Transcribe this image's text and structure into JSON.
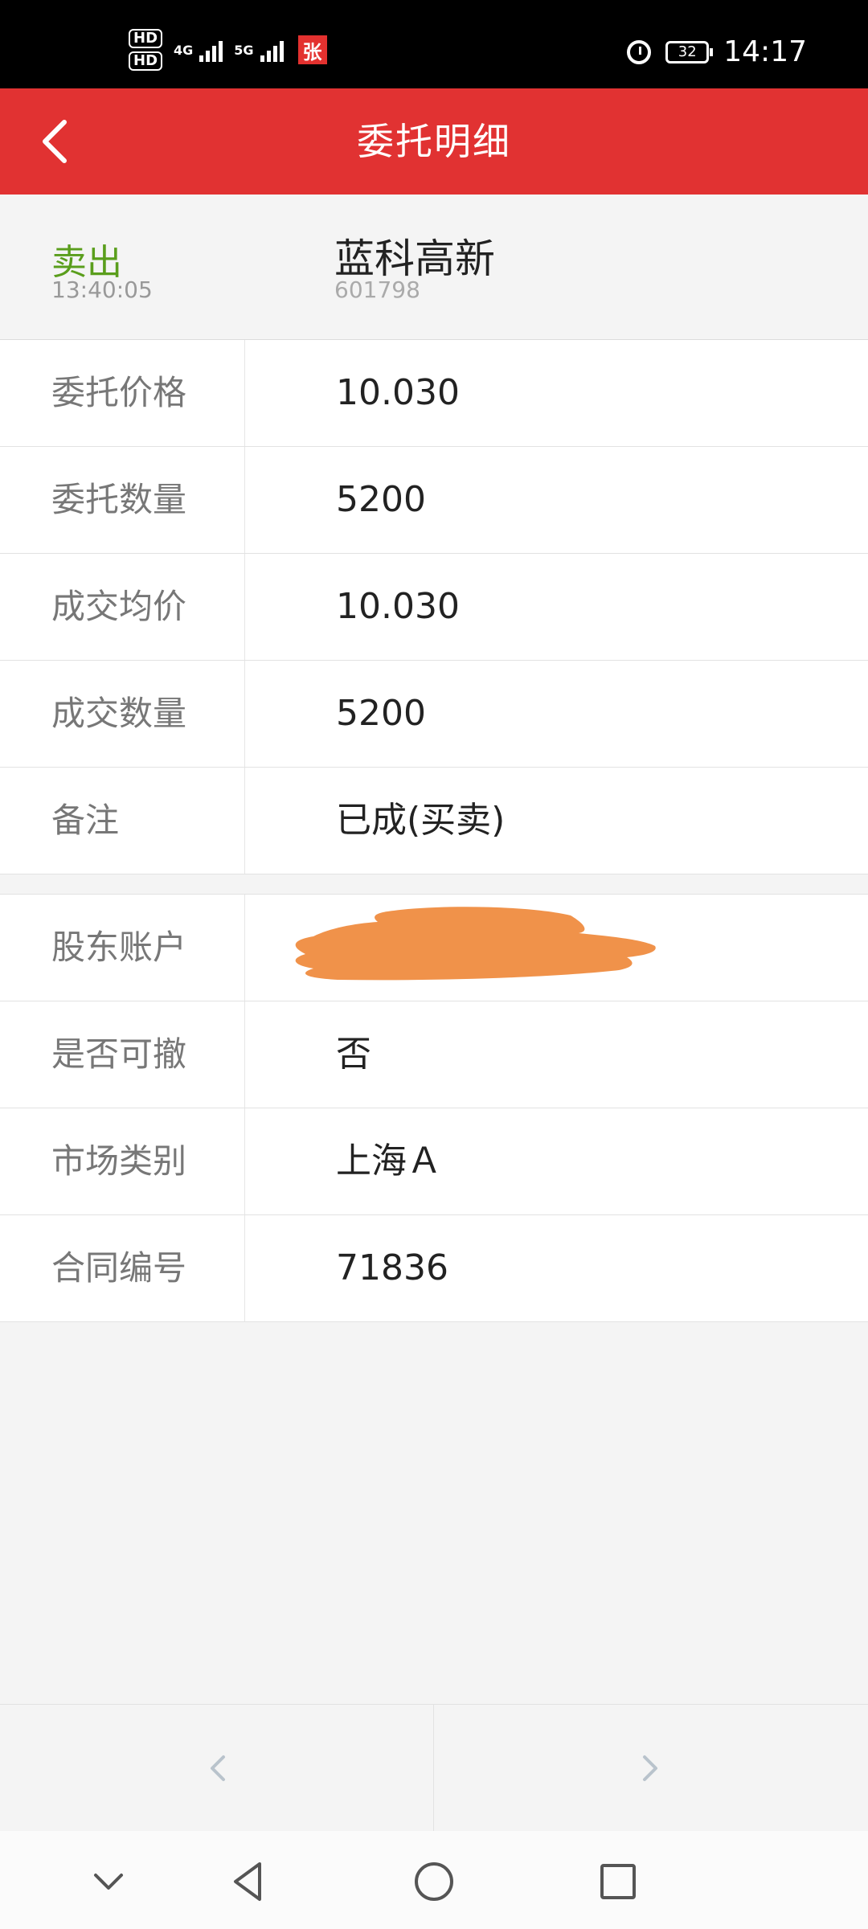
{
  "status_bar": {
    "hd1": "HD",
    "hd2": "HD",
    "sim1_type": "4G",
    "sim2_type": "5G",
    "app_badge": "张",
    "battery": "32",
    "time": "14:17"
  },
  "header": {
    "title": "委托明细"
  },
  "summary": {
    "side": "卖出",
    "time": "13:40:05",
    "stock_name": "蓝科高新",
    "stock_code": "601798",
    "side_color": "#5a9e1c"
  },
  "details": [
    {
      "label": "委托价格",
      "value": "10.030"
    },
    {
      "label": "委托数量",
      "value": "5200"
    },
    {
      "label": "成交均价",
      "value": "10.030"
    },
    {
      "label": "成交数量",
      "value": "5200"
    },
    {
      "label": "备注",
      "value": "已成(买卖)"
    }
  ],
  "extra": [
    {
      "label": "股东账户",
      "value": ""
    },
    {
      "label": "是否可撤",
      "value": "否"
    },
    {
      "label": "市场类别",
      "value": "上海Ａ"
    },
    {
      "label": "合同编号",
      "value": "71836"
    }
  ],
  "pager": {
    "prev_icon": "chevron-left-icon",
    "next_icon": "chevron-right-icon"
  },
  "colors": {
    "header_bg": "#e13232",
    "redaction": "#f0924a"
  }
}
